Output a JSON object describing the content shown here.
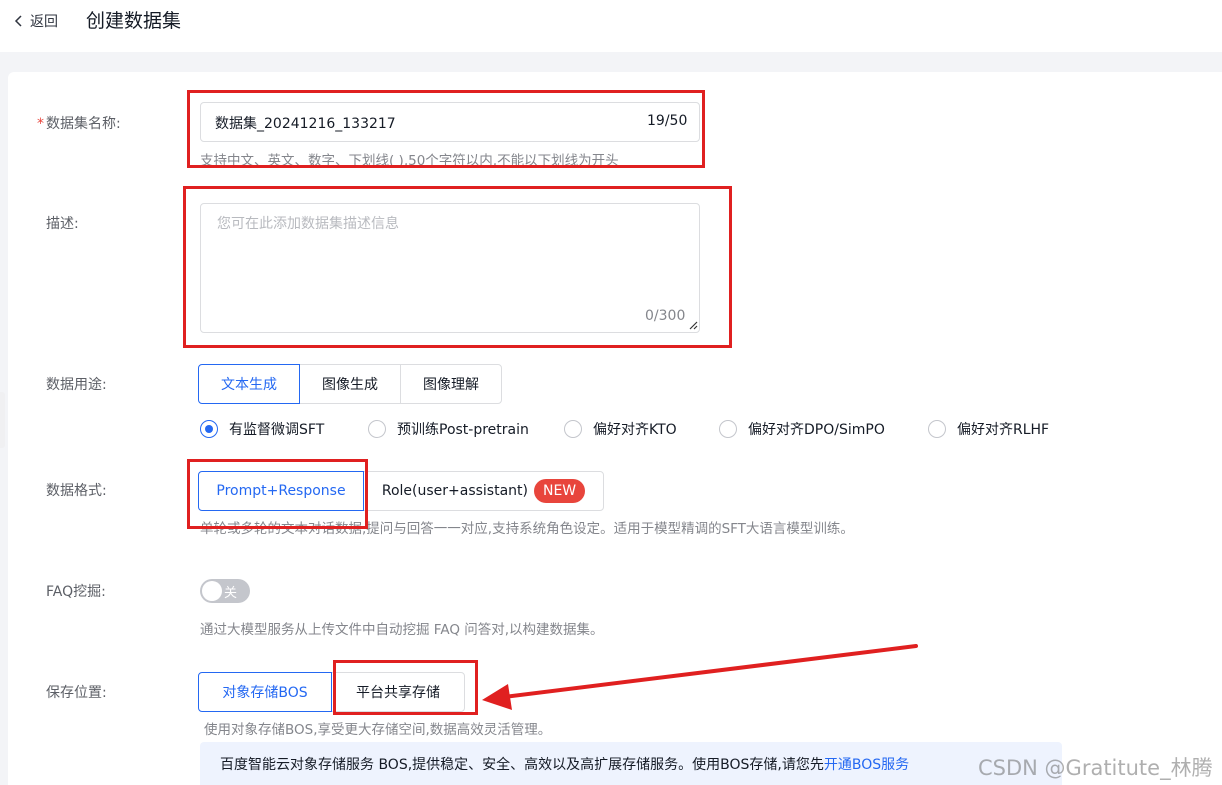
{
  "header": {
    "back_label": "返回",
    "title": "创建数据集"
  },
  "form": {
    "name": {
      "label": "数据集名称:",
      "required_mark": "*",
      "value": "数据集_20241216_133217",
      "counter": "19/50",
      "hint": "支持中文、英文、数字、下划线( ),50个字符以内,不能以下划线为开头"
    },
    "description": {
      "label": "描述:",
      "placeholder": "您可在此添加数据集描述信息",
      "counter": "0/300"
    },
    "usage": {
      "label": "数据用途:",
      "tabs": [
        "文本生成",
        "图像生成",
        "图像理解"
      ],
      "selected_tab": "文本生成",
      "radios": [
        "有监督微调SFT",
        "预训练Post-pretrain",
        "偏好对齐KTO",
        "偏好对齐DPO/SimPO",
        "偏好对齐RLHF"
      ],
      "selected_radio": "有监督微调SFT"
    },
    "format": {
      "label": "数据格式:",
      "options": [
        "Prompt+Response",
        "Role(user+assistant)"
      ],
      "selected": "Prompt+Response",
      "new_badge": "NEW",
      "hint": "单轮或多轮的文本对话数据,提问与回答一一对应,支持系统角色设定。适用于模型精调的SFT大语言模型训练。"
    },
    "faq": {
      "label": "FAQ挖掘:",
      "toggle_text": "关",
      "enabled": false,
      "hint": "通过大模型服务从上传文件中自动挖掘 FAQ 问答对,以构建数据集。"
    },
    "storage": {
      "label": "保存位置:",
      "options": [
        "对象存储BOS",
        "平台共享存储"
      ],
      "selected": "对象存储BOS",
      "hint": "使用对象存储BOS,享受更大存储空间,数据高效灵活管理。",
      "info_text": "百度智能云对象存储服务 BOS,提供稳定、安全、高效以及高扩展存储服务。使用BOS存储,请您先",
      "info_link": "开通BOS服务"
    }
  },
  "watermark": "CSDN @Gratitute_林腾",
  "colors": {
    "primary": "#2468f2",
    "annotation_red": "#e02020",
    "badge_red": "#e8453c"
  }
}
